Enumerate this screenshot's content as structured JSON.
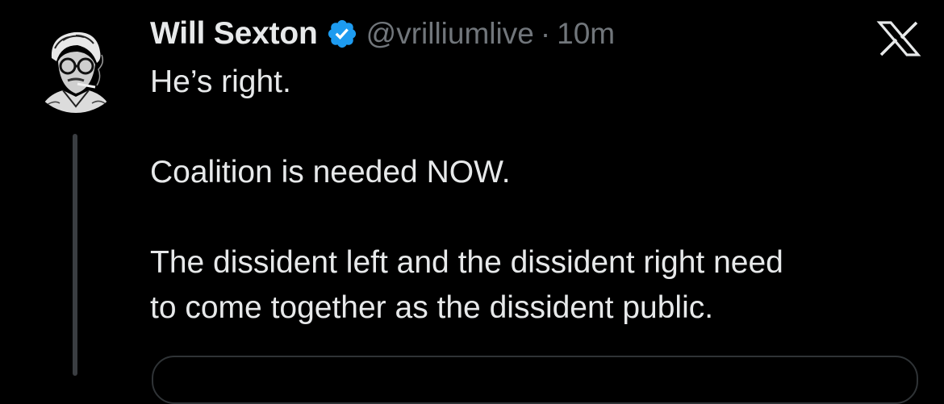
{
  "post": {
    "author": {
      "display_name": "Will Sexton",
      "handle": "@vrilliumlive",
      "verified": true,
      "avatar_icon": "avatar-portrait-icon"
    },
    "separator": "·",
    "timestamp": "10m",
    "text": {
      "line1": "He’s right.",
      "line2": "Coalition is needed NOW.",
      "line3": "The dissident left and the dissident right need",
      "line4": "to come together as the dissident public."
    }
  },
  "controls": {
    "close_icon": "x-close-icon"
  },
  "colors": {
    "background": "#000000",
    "text_primary": "#e7e9ea",
    "text_secondary": "#71767b",
    "verified_badge": "#1d9bf0",
    "thread_line": "#3a3d41",
    "border": "#2f3336"
  }
}
